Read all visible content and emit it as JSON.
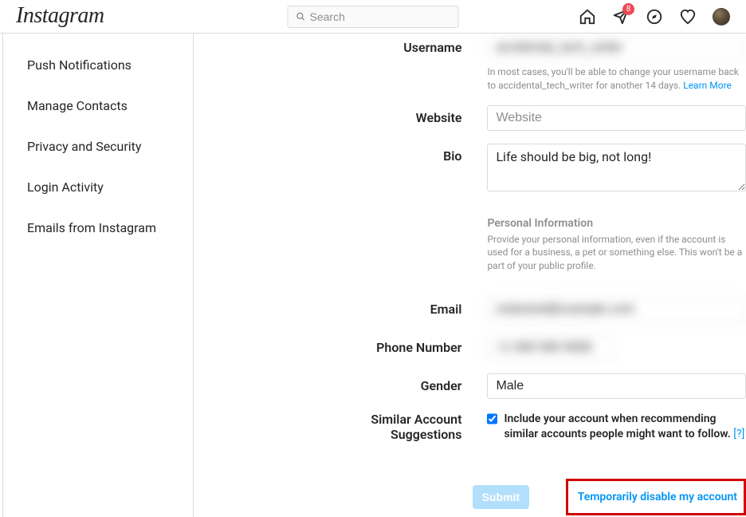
{
  "topnav": {
    "logo": "Instagram",
    "search_placeholder": "Search",
    "badge_count": "8"
  },
  "sidebar": {
    "items": [
      {
        "label": "Push Notifications"
      },
      {
        "label": "Manage Contacts"
      },
      {
        "label": "Privacy and Security"
      },
      {
        "label": "Login Activity"
      },
      {
        "label": "Emails from Instagram"
      }
    ]
  },
  "form": {
    "username": {
      "label": "Username",
      "value": "accidental_tech_writer",
      "helper_prefix": "In most cases, you'll be able to change your username back to accidental_tech_writer for another 14 days. ",
      "helper_link": "Learn More"
    },
    "website": {
      "label": "Website",
      "placeholder": "Website",
      "value": ""
    },
    "bio": {
      "label": "Bio",
      "value": "Life should be big, not long!"
    },
    "personal_info": {
      "title": "Personal Information",
      "desc": "Provide your personal information, even if the account is used for a business, a pet or something else. This won't be a part of your public profile."
    },
    "email": {
      "label": "Email",
      "value": "redacted@example.com"
    },
    "phone": {
      "label": "Phone Number",
      "value": "+1 000 000 0000"
    },
    "gender": {
      "label": "Gender",
      "value": "Male"
    },
    "similar": {
      "label_line1": "Similar Account",
      "label_line2": "Suggestions",
      "checkbox_label": "Include your account when recommending similar accounts people might want to follow.  ",
      "help_link": "[?]",
      "checked": true
    },
    "submit": "Submit",
    "disable": "Temporarily disable my account"
  }
}
